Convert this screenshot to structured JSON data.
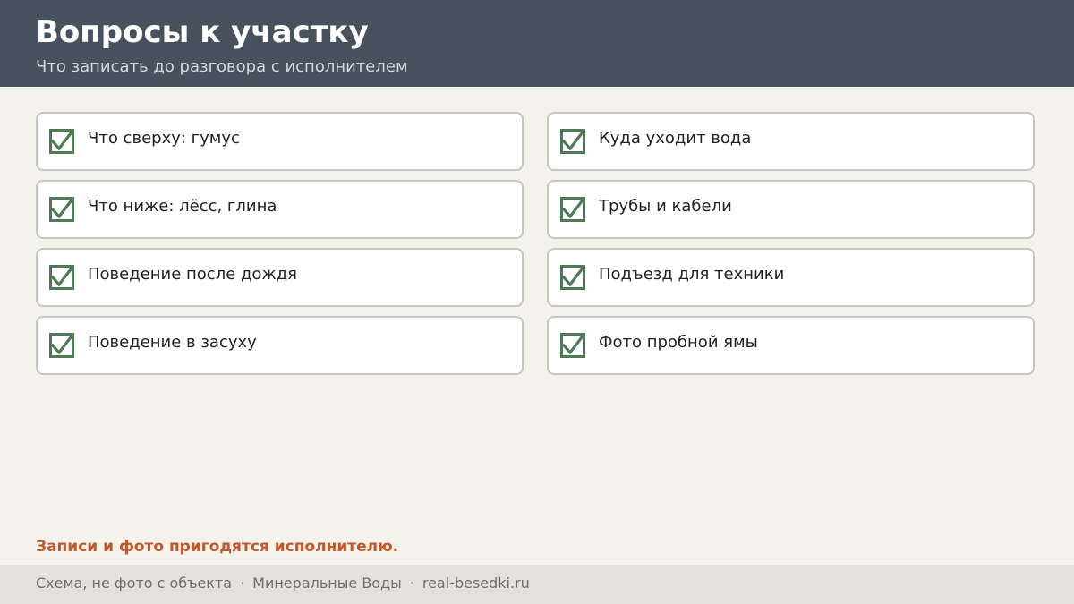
{
  "header": {
    "title": "Вопросы к участку",
    "subtitle": "Что записать до разговора с исполнителем"
  },
  "checklist": [
    {
      "label": "Что сверху: гумус",
      "checked": true
    },
    {
      "label": "Куда уходит вода",
      "checked": true
    },
    {
      "label": "Что ниже: лёсс, глина",
      "checked": true
    },
    {
      "label": "Трубы и кабели",
      "checked": true
    },
    {
      "label": "Поведение после дождя",
      "checked": true
    },
    {
      "label": "Подъезд для техники",
      "checked": true
    },
    {
      "label": "Поведение в засуху",
      "checked": true
    },
    {
      "label": "Фото пробной ямы",
      "checked": true
    }
  ],
  "note": "Записи и фото пригодятся исполнителю.",
  "footer": {
    "part1": "Схема, не фото с объекта",
    "separator": "·",
    "part2": "Минеральные Воды",
    "part3": "real-besedki.ru"
  },
  "colors": {
    "header_bg": "#48525e",
    "check_green": "#4e7a55",
    "accent_orange": "#c0582a"
  }
}
